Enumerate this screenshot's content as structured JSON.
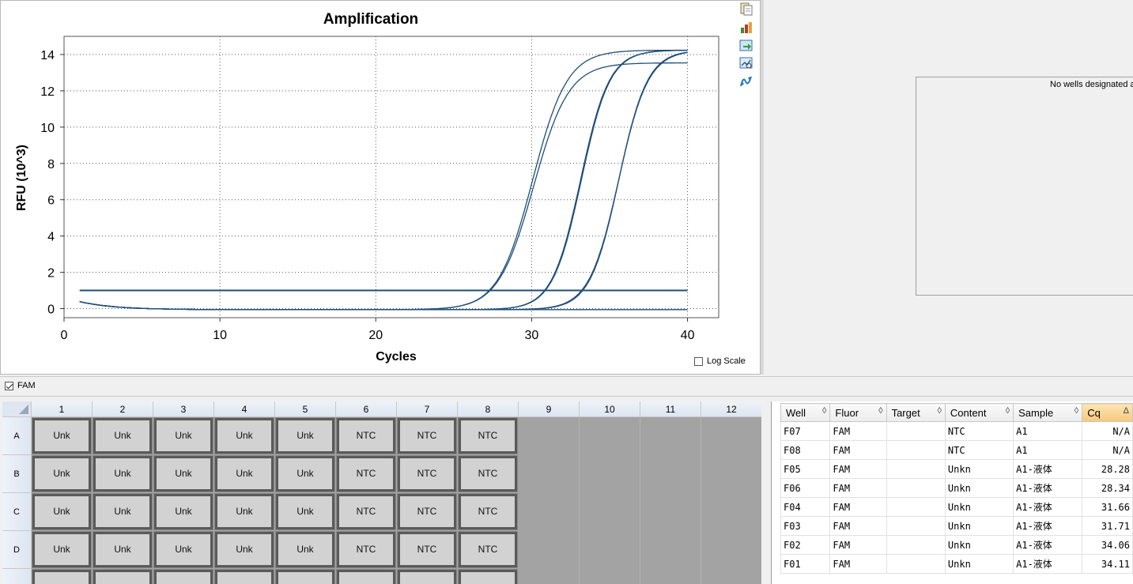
{
  "chart": {
    "title": "Amplification",
    "xlabel": "Cycles",
    "ylabel": "RFU (10^3)",
    "log_scale_label": "Log Scale",
    "log_scale_checked": false
  },
  "chart_data": {
    "type": "line",
    "title": "Amplification",
    "xlabel": "Cycles",
    "ylabel": "RFU (10^3)",
    "xlim": [
      0,
      42
    ],
    "ylim": [
      -0.5,
      15
    ],
    "x_ticks": [
      0,
      10,
      20,
      30,
      40
    ],
    "y_ticks": [
      0,
      2,
      4,
      6,
      8,
      10,
      12,
      14
    ],
    "grid": true,
    "threshold": 1.0,
    "line_color": "#1f4e79",
    "series": [
      {
        "name": "F05",
        "cq": 28.28,
        "plateau": 14.3,
        "slope": 1.45
      },
      {
        "name": "F06",
        "cq": 28.34,
        "plateau": 13.6,
        "slope": 1.42
      },
      {
        "name": "F04",
        "cq": 31.66,
        "plateau": 14.3,
        "slope": 1.75
      },
      {
        "name": "F03",
        "cq": 31.71,
        "plateau": 14.3,
        "slope": 1.75
      },
      {
        "name": "F02",
        "cq": 34.06,
        "plateau": 14.3,
        "slope": 1.7
      },
      {
        "name": "F01",
        "cq": 34.11,
        "plateau": 14.3,
        "slope": 1.75
      },
      {
        "name": "F07",
        "cq": null,
        "plateau": 0,
        "slope": 1
      },
      {
        "name": "F08",
        "cq": null,
        "plateau": 0,
        "slope": 1
      }
    ]
  },
  "toolbar": {
    "icons": [
      "copy-icon",
      "export-icon",
      "save-image-icon",
      "chart-options-icon",
      "trace-style-icon"
    ]
  },
  "right_panel": {
    "message": "No wells designated as"
  },
  "fluor_filter": {
    "label": "FAM",
    "checked": true
  },
  "plate": {
    "columns": [
      "1",
      "2",
      "3",
      "4",
      "5",
      "6",
      "7",
      "8",
      "9",
      "10",
      "11",
      "12"
    ],
    "rows": [
      {
        "label": "A",
        "wells": [
          "Unk",
          "Unk",
          "Unk",
          "Unk",
          "Unk",
          "NTC",
          "NTC",
          "NTC",
          "",
          "",
          "",
          ""
        ]
      },
      {
        "label": "B",
        "wells": [
          "Unk",
          "Unk",
          "Unk",
          "Unk",
          "Unk",
          "NTC",
          "NTC",
          "NTC",
          "",
          "",
          "",
          ""
        ]
      },
      {
        "label": "C",
        "wells": [
          "Unk",
          "Unk",
          "Unk",
          "Unk",
          "Unk",
          "NTC",
          "NTC",
          "NTC",
          "",
          "",
          "",
          ""
        ]
      },
      {
        "label": "D",
        "wells": [
          "Unk",
          "Unk",
          "Unk",
          "Unk",
          "Unk",
          "NTC",
          "NTC",
          "NTC",
          "",
          "",
          "",
          ""
        ]
      },
      {
        "label": "",
        "wells": [
          "",
          "",
          "",
          "",
          "",
          "",
          "",
          "",
          "",
          "",
          "",
          ""
        ]
      }
    ]
  },
  "results_table": {
    "columns": [
      "Well",
      "Fluor",
      "Target",
      "Content",
      "Sample",
      "Cq"
    ],
    "sort_icon": "◊",
    "active_sort_icon": "Δ",
    "rows": [
      [
        "F07",
        "FAM",
        "",
        "NTC",
        "A1",
        "N/A"
      ],
      [
        "F08",
        "FAM",
        "",
        "NTC",
        "A1",
        "N/A"
      ],
      [
        "F05",
        "FAM",
        "",
        "Unkn",
        "A1-液体",
        "28.28"
      ],
      [
        "F06",
        "FAM",
        "",
        "Unkn",
        "A1-液体",
        "28.34"
      ],
      [
        "F04",
        "FAM",
        "",
        "Unkn",
        "A1-液体",
        "31.66"
      ],
      [
        "F03",
        "FAM",
        "",
        "Unkn",
        "A1-液体",
        "31.71"
      ],
      [
        "F02",
        "FAM",
        "",
        "Unkn",
        "A1-液体",
        "34.06"
      ],
      [
        "F01",
        "FAM",
        "",
        "Unkn",
        "A1-液体",
        "34.11"
      ]
    ]
  }
}
